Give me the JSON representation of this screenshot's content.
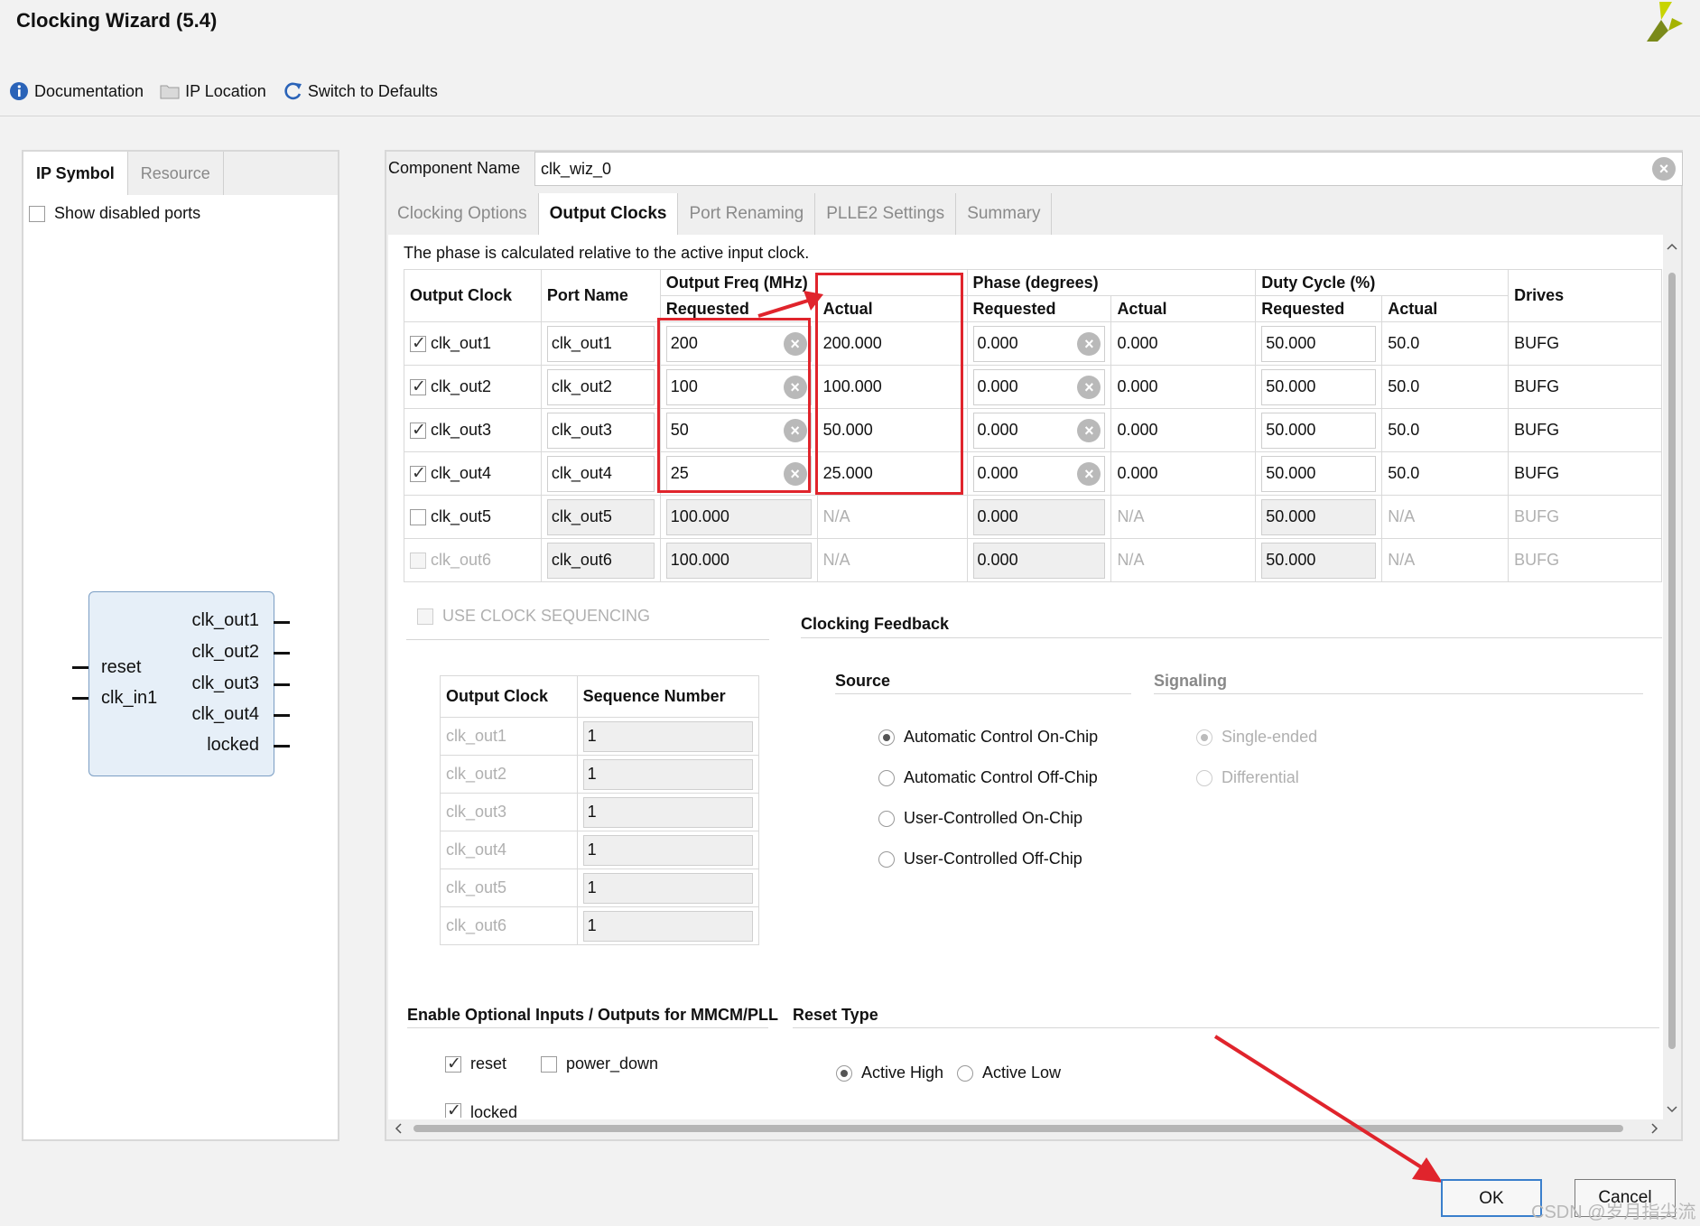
{
  "window": {
    "title": "Clocking Wizard (5.4)"
  },
  "toolbar": {
    "documentation": "Documentation",
    "ip_location": "IP Location",
    "switch_defaults": "Switch to Defaults"
  },
  "left": {
    "tabs": [
      "IP Symbol",
      "Resource"
    ],
    "show_disabled": "Show disabled ports",
    "symbol": {
      "inputs": [
        "reset",
        "clk_in1"
      ],
      "outputs": [
        "clk_out1",
        "clk_out2",
        "clk_out3",
        "clk_out4",
        "locked"
      ]
    }
  },
  "component": {
    "label": "Component Name",
    "value": "clk_wiz_0"
  },
  "tabs": [
    "Clocking Options",
    "Output Clocks",
    "Port Renaming",
    "PLLE2 Settings",
    "Summary"
  ],
  "note": "The phase is calculated relative to the active input clock.",
  "table": {
    "headers": {
      "output_clock": "Output Clock",
      "port_name": "Port Name",
      "output_freq": "Output Freq (MHz)",
      "phase": "Phase (degrees)",
      "duty_cycle": "Duty Cycle (%)",
      "drives": "Drives",
      "requested": "Requested",
      "actual": "Actual"
    },
    "rows": [
      {
        "name": "clk_out1",
        "port": "clk_out1",
        "freq_req": "200",
        "freq_act": "200.000",
        "phase_req": "0.000",
        "phase_act": "0.000",
        "duty_req": "50.000",
        "duty_act": "50.0",
        "drives": "BUFG"
      },
      {
        "name": "clk_out2",
        "port": "clk_out2",
        "freq_req": "100",
        "freq_act": "100.000",
        "phase_req": "0.000",
        "phase_act": "0.000",
        "duty_req": "50.000",
        "duty_act": "50.0",
        "drives": "BUFG"
      },
      {
        "name": "clk_out3",
        "port": "clk_out3",
        "freq_req": "50",
        "freq_act": "50.000",
        "phase_req": "0.000",
        "phase_act": "0.000",
        "duty_req": "50.000",
        "duty_act": "50.0",
        "drives": "BUFG"
      },
      {
        "name": "clk_out4",
        "port": "clk_out4",
        "freq_req": "25",
        "freq_act": "25.000",
        "phase_req": "0.000",
        "phase_act": "0.000",
        "duty_req": "50.000",
        "duty_act": "50.0",
        "drives": "BUFG"
      },
      {
        "name": "clk_out5",
        "port": "clk_out5",
        "freq_req": "100.000",
        "freq_act": "N/A",
        "phase_req": "0.000",
        "phase_act": "N/A",
        "duty_req": "50.000",
        "duty_act": "N/A",
        "drives": "BUFG"
      },
      {
        "name": "clk_out6",
        "port": "clk_out6",
        "freq_req": "100.000",
        "freq_act": "N/A",
        "phase_req": "0.000",
        "phase_act": "N/A",
        "duty_req": "50.000",
        "duty_act": "N/A",
        "drives": "BUFG"
      }
    ]
  },
  "sequencing": {
    "label": "USE CLOCK SEQUENCING",
    "headers": [
      "Output Clock",
      "Sequence Number"
    ],
    "rows": [
      {
        "clock": "clk_out1",
        "seq": "1"
      },
      {
        "clock": "clk_out2",
        "seq": "1"
      },
      {
        "clock": "clk_out3",
        "seq": "1"
      },
      {
        "clock": "clk_out4",
        "seq": "1"
      },
      {
        "clock": "clk_out5",
        "seq": "1"
      },
      {
        "clock": "clk_out6",
        "seq": "1"
      }
    ]
  },
  "feedback": {
    "title": "Clocking Feedback",
    "source_label": "Source",
    "signaling_label": "Signaling",
    "sources": [
      "Automatic Control On-Chip",
      "Automatic Control Off-Chip",
      "User-Controlled On-Chip",
      "User-Controlled Off-Chip"
    ],
    "signaling": [
      "Single-ended",
      "Differential"
    ]
  },
  "optional": {
    "title": "Enable Optional Inputs / Outputs for MMCM/PLL",
    "reset": "reset",
    "power_down": "power_down",
    "locked": "locked"
  },
  "reset_type": {
    "title": "Reset Type",
    "high": "Active High",
    "low": "Active Low"
  },
  "buttons": {
    "ok": "OK",
    "cancel": "Cancel"
  },
  "watermark": "CSDN @岁月指尖流",
  "colors": {
    "highlight": "#e0242c",
    "accent": "#3a7fcc"
  }
}
